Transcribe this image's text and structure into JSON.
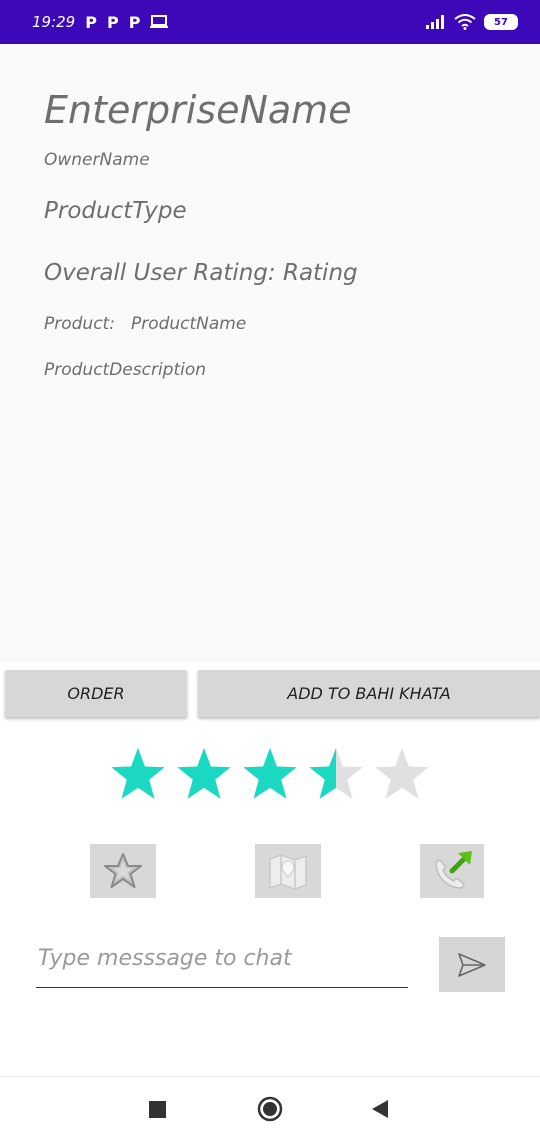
{
  "status_bar": {
    "time": "19:29",
    "notification_icons": [
      "P",
      "P",
      "P"
    ],
    "battery": "57"
  },
  "details": {
    "enterprise_name": "EnterpriseName",
    "owner_name": "OwnerName",
    "product_type": "ProductType",
    "rating_text": "Overall User Rating: Rating",
    "product_label": "Product:",
    "product_name": "ProductName",
    "product_description": "ProductDescription"
  },
  "actions": {
    "order_label": "ORDER",
    "add_to_bahi_khata_label": "ADD TO BAHI KHATA"
  },
  "rating_bar": {
    "value": 3.5,
    "max": 5,
    "filled_color": "#1bd8c2",
    "empty_color": "#e0e0e0"
  },
  "icon_buttons": [
    "star-icon",
    "map-icon",
    "call-forward-icon"
  ],
  "chat": {
    "placeholder": "Type messsage to chat",
    "value": ""
  }
}
